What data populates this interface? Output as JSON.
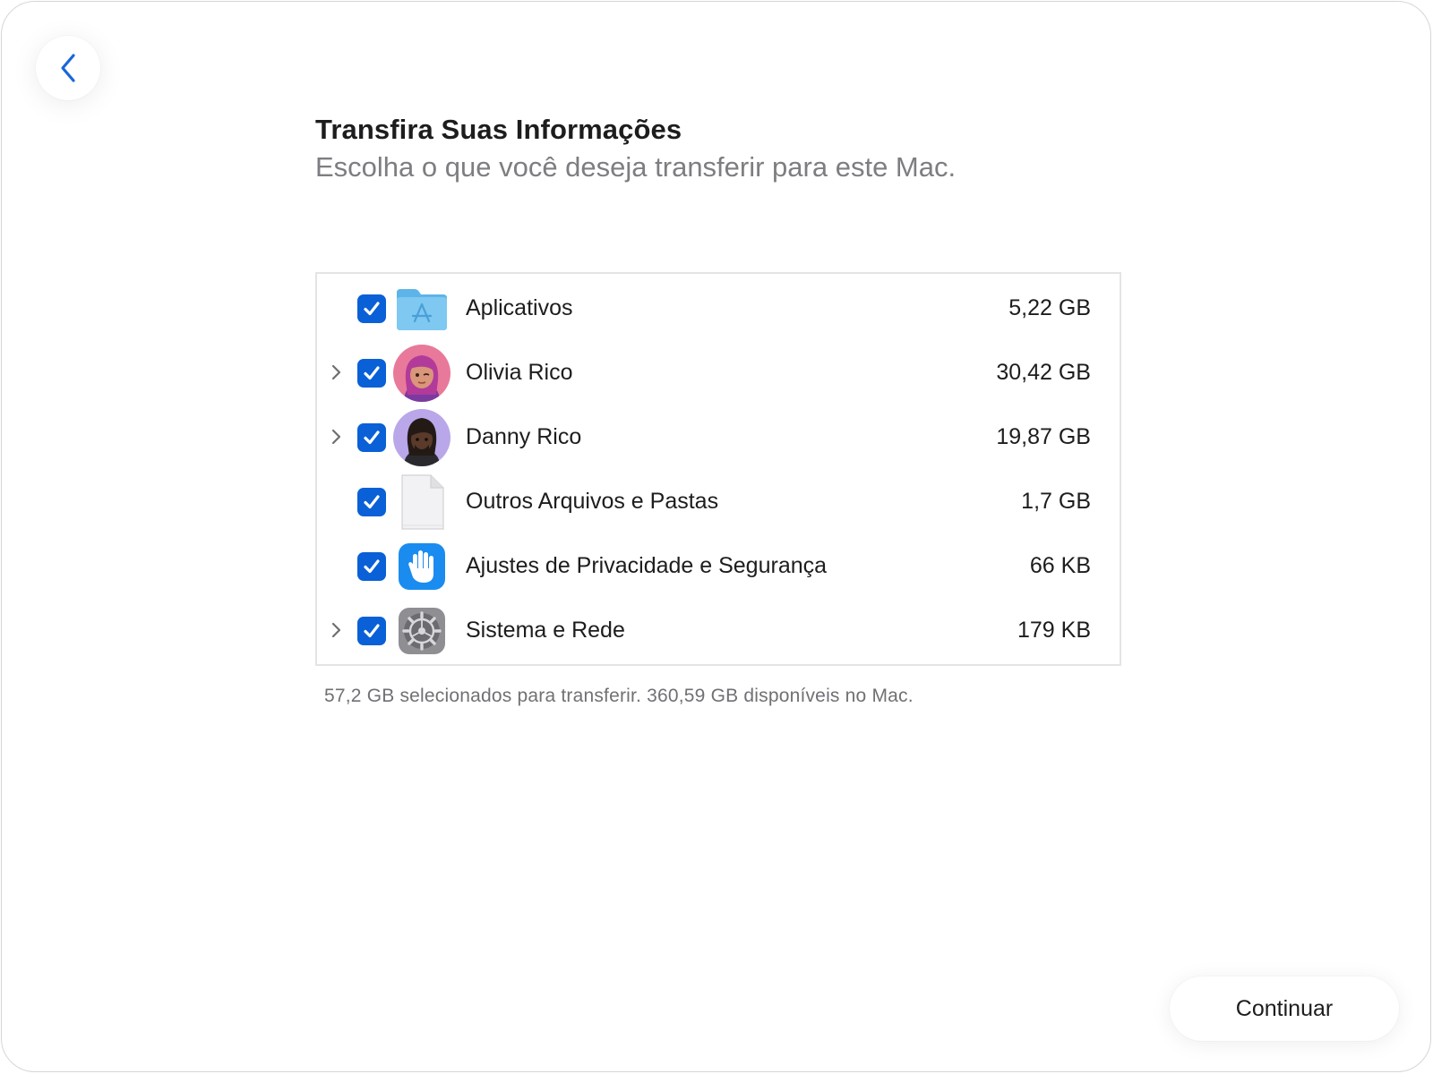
{
  "header": {
    "title": "Transfira Suas Informações",
    "subtitle": "Escolha o que você deseja transferir para este Mac."
  },
  "items": [
    {
      "label": "Aplicativos",
      "size": "5,22 GB",
      "checked": true,
      "expandable": false,
      "icon": "app-folder-icon"
    },
    {
      "label": "Olivia Rico",
      "size": "30,42 GB",
      "checked": true,
      "expandable": true,
      "icon": "olivia-avatar"
    },
    {
      "label": "Danny Rico",
      "size": "19,87 GB",
      "checked": true,
      "expandable": true,
      "icon": "danny-avatar"
    },
    {
      "label": "Outros Arquivos e Pastas",
      "size": "1,7 GB",
      "checked": true,
      "expandable": false,
      "icon": "document-icon"
    },
    {
      "label": "Ajustes de Privacidade e Segurança",
      "size": "66 KB",
      "checked": true,
      "expandable": false,
      "icon": "privacy-hand-icon"
    },
    {
      "label": "Sistema e Rede",
      "size": "179 KB",
      "checked": true,
      "expandable": true,
      "icon": "system-settings-gear-icon"
    }
  ],
  "summary": "57,2 GB selecionados para transferir. 360,59 GB disponíveis no Mac.",
  "continue_label": "Continuar",
  "colors": {
    "accent": "#0a60d6",
    "back_chevron": "#1a66d9",
    "secondary_text": "#7d7d82"
  }
}
